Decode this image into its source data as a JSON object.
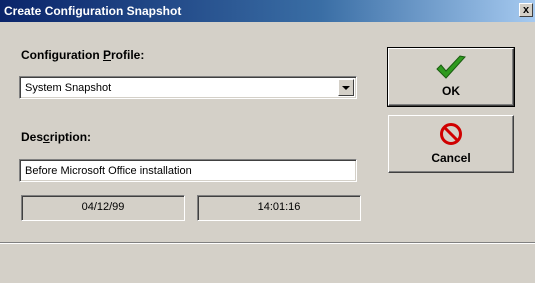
{
  "window": {
    "title": "Create Configuration Snapshot",
    "close_glyph": "x"
  },
  "profile": {
    "label_pre": "Configuration ",
    "label_accel": "P",
    "label_post": "rofile:",
    "selected": "System Snapshot"
  },
  "description": {
    "label_pre": "Des",
    "label_accel": "c",
    "label_post": "ription:",
    "value": "Before Microsoft Office installation"
  },
  "fields": {
    "date": "04/12/99",
    "time": "14:01:16"
  },
  "buttons": {
    "ok_label": "OK",
    "ok_icon": "checkmark-icon",
    "cancel_label": "Cancel",
    "cancel_icon": "no-symbol-icon"
  },
  "colors": {
    "check": "#2f9a1f",
    "cancel": "#d00000"
  }
}
